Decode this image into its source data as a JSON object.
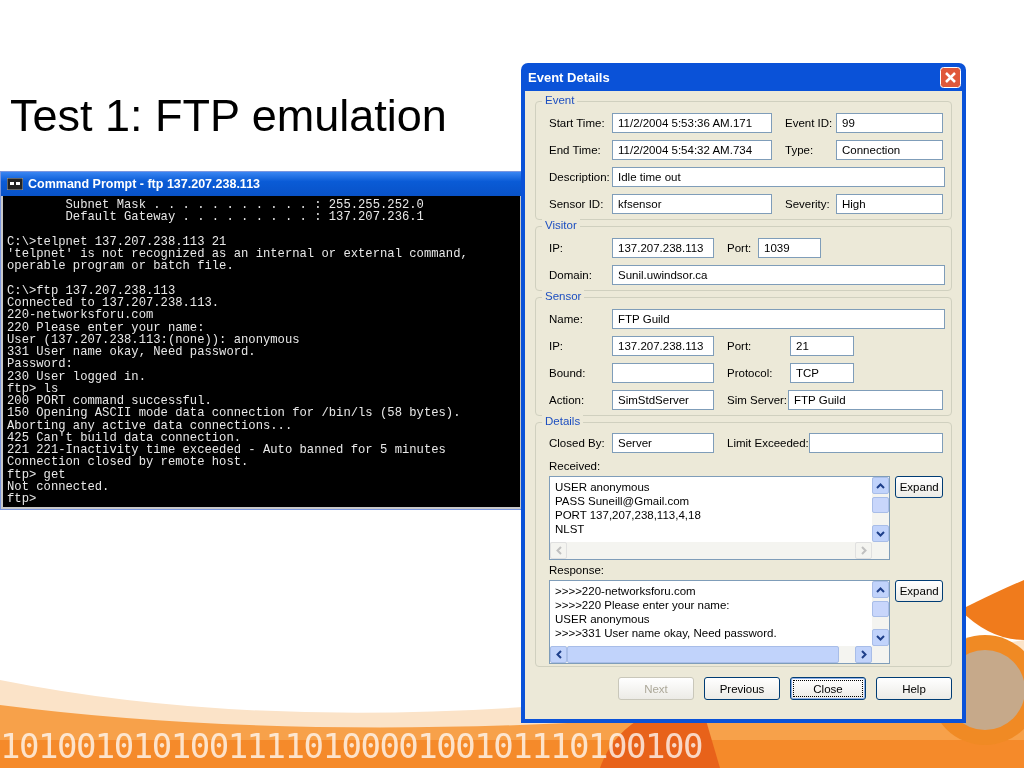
{
  "slide": {
    "title": "Test 1: FTP emulation",
    "binary_row": "1010010101001111010000100101110100100"
  },
  "console": {
    "title": "Command Prompt - ftp 137.207.238.113",
    "blocks": [
      [
        "        Subnet Mask . . . . . . . . . . . : 255.255.252.0",
        "        Default Gateway . . . . . . . . . : 137.207.236.1"
      ],
      [
        "C:\\>telpnet 137.207.238.113 21",
        "'telpnet' is not recognized as an internal or external command,",
        "operable program or batch file."
      ],
      [
        "C:\\>ftp 137.207.238.113",
        "Connected to 137.207.238.113.",
        "220-networksforu.com",
        "220 Please enter your name:",
        "User (137.207.238.113:(none)): anonymous",
        "331 User name okay, Need password.",
        "Password:",
        "230 User logged in.",
        "ftp> ls",
        "200 PORT command successful.",
        "150 Opening ASCII mode data connection for /bin/ls (58 bytes).",
        "Aborting any active data connections...",
        "425 Can't build data connection.",
        "221 221-Inactivity time exceeded - Auto banned for 5 minutes",
        "Connection closed by remote host.",
        "ftp> get",
        "Not connected.",
        "ftp>"
      ]
    ]
  },
  "dialog": {
    "title": "Event Details",
    "sections": [
      {
        "legend": "Event",
        "rows": [
          [
            {
              "label": "Start Time:",
              "value": "11/2/2004 5:53:36 AM.171"
            },
            {
              "label": "Event ID:",
              "value": "99"
            }
          ],
          [
            {
              "label": "End Time:",
              "value": "11/2/2004 5:54:32 AM.734"
            },
            {
              "label": "Type:",
              "value": "Connection"
            }
          ],
          [
            {
              "label": "Description:",
              "value": "Idle time out"
            }
          ],
          [
            {
              "label": "Sensor ID:",
              "value": "kfsensor"
            },
            {
              "label": "Severity:",
              "value": "High"
            }
          ]
        ]
      },
      {
        "legend": "Visitor",
        "rows": [
          [
            {
              "label": "IP:",
              "value": "137.207.238.113"
            },
            {
              "label": "Port:",
              "value": "1039"
            }
          ],
          [
            {
              "label": "Domain:",
              "value": "Sunil.uwindsor.ca"
            }
          ]
        ]
      },
      {
        "legend": "Sensor",
        "rows": [
          [
            {
              "label": "Name:",
              "value": "FTP Guild"
            }
          ],
          [
            {
              "label": "IP:",
              "value": "137.207.238.113"
            },
            {
              "label": "Port:",
              "value": "21"
            }
          ],
          [
            {
              "label": "Bound:"
            },
            {
              "label": "Protocol:",
              "value": "TCP"
            }
          ],
          [
            {
              "label": "Action:",
              "value": "SimStdServer"
            },
            {
              "label": "Sim Server:",
              "value": "FTP Guild"
            }
          ]
        ]
      },
      {
        "legend": "Details",
        "rows": [
          [
            {
              "label": "Closed By:",
              "value": "Server"
            },
            {
              "label": "Limit Exceeded:"
            }
          ]
        ]
      }
    ],
    "logs": [
      {
        "label": "Received:",
        "lines": [
          "USER anonymous",
          "PASS Suneill@Gmail.com",
          "PORT 137,207,238,113,4,18",
          "NLST"
        ],
        "button": "Expand",
        "h_scroll_enabled": false
      },
      {
        "label": "Response:",
        "lines": [
          ">>>>220-networksforu.com",
          ">>>>220 Please enter your name:",
          "USER anonymous",
          ">>>>331 User name okay, Need password."
        ],
        "button": "Expand",
        "h_scroll_enabled": true
      }
    ],
    "buttons": [
      {
        "label": "Next",
        "disabled": true,
        "default": false
      },
      {
        "label": "Previous",
        "disabled": false,
        "default": false
      },
      {
        "label": "Close",
        "disabled": false,
        "default": true
      },
      {
        "label": "Help",
        "disabled": false,
        "default": false
      }
    ]
  }
}
